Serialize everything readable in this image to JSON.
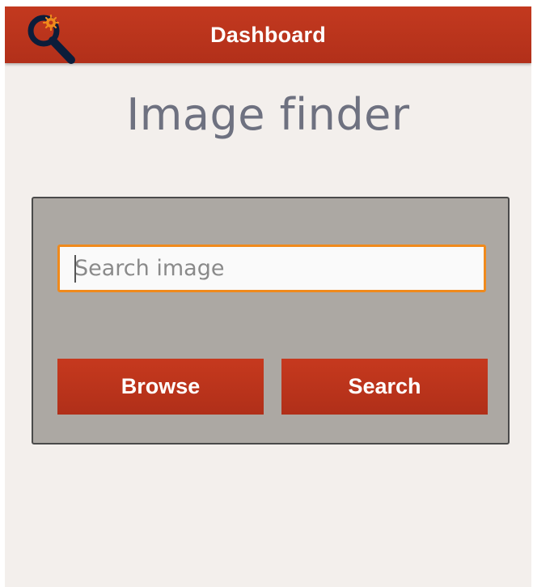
{
  "header": {
    "title": "Dashboard",
    "icon": "search-magnifier-icon",
    "bar_color": "#b8321b"
  },
  "main": {
    "page_title": "Image finder",
    "search": {
      "placeholder": "Search image",
      "value": "",
      "focus_color": "#f08a1c"
    },
    "buttons": {
      "browse_label": "Browse",
      "search_label": "Search"
    }
  }
}
